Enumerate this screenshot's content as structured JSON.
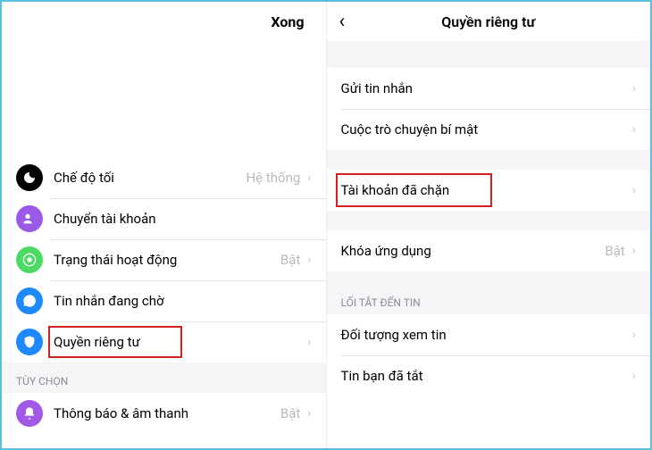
{
  "left": {
    "done": "Xong",
    "rows": {
      "dark": {
        "label": "Chế độ tối",
        "value": "Hệ thống"
      },
      "switch": {
        "label": "Chuyển tài khoản"
      },
      "active": {
        "label": "Trạng thái hoạt động",
        "value": "Bật"
      },
      "waiting": {
        "label": "Tin nhắn đang chờ"
      },
      "privacy": {
        "label": "Quyền riêng tư"
      }
    },
    "section_options": "TÙY CHỌN",
    "rows2": {
      "notif": {
        "label": "Thông báo & âm thanh",
        "value": "Bật"
      }
    }
  },
  "right": {
    "title": "Quyền riêng tư",
    "rows": {
      "send": {
        "label": "Gửi tin nhắn"
      },
      "secret": {
        "label": "Cuộc trò chuyện bí mật"
      },
      "blocked": {
        "label": "Tài khoản đã chặn"
      },
      "lock": {
        "label": "Khóa ứng dụng",
        "value": "Bật"
      }
    },
    "section_story": "LỐI TẮT ĐẾN TIN",
    "rows2": {
      "audience": {
        "label": "Đối tượng xem tin"
      },
      "muted": {
        "label": "Tin bạn đã tắt"
      }
    }
  }
}
